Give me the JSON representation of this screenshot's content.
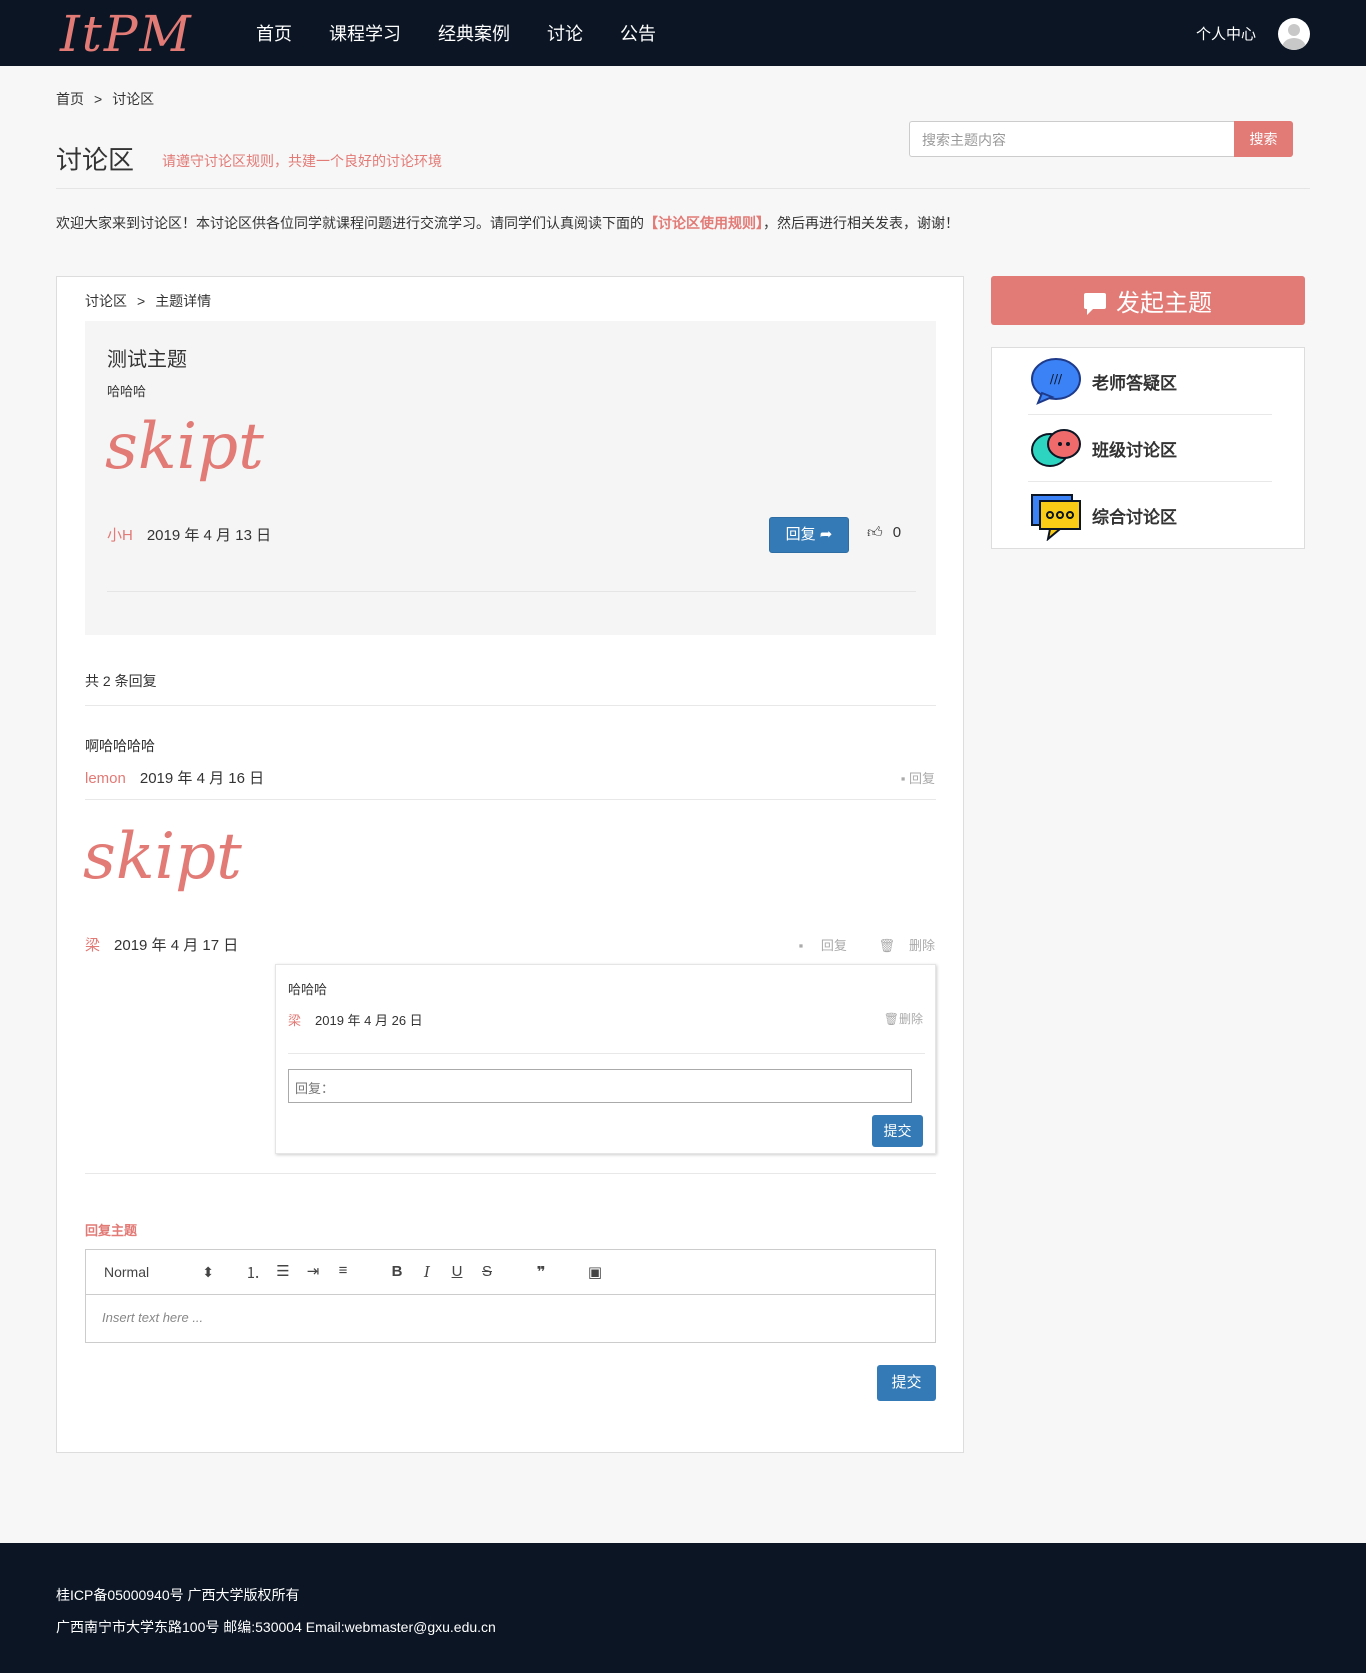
{
  "header": {
    "logo": "ItPM",
    "nav": [
      "首页",
      "课程学习",
      "经典案例",
      "讨论",
      "公告"
    ],
    "user_center": "个人中心"
  },
  "breadcrumb": {
    "home": "首页",
    "sep": ">",
    "current": "讨论区"
  },
  "page": {
    "title": "讨论区",
    "subtitle": "请遵守讨论区规则，共建一个良好的讨论环境",
    "search_placeholder": "搜索主题内容",
    "search_button": "搜索",
    "welcome_before": "欢迎大家来到讨论区！本讨论区供各位同学就课程问题进行交流学习。请同学们认真阅读下面的",
    "welcome_rule": "【讨论区使用规则】",
    "welcome_after": "，然后再进行相关发表，谢谢！"
  },
  "topic_panel": {
    "crumb_parent": "讨论区",
    "crumb_sep": ">",
    "crumb_current": "主题详情",
    "topic": {
      "title": "测试主题",
      "body": "哈哈哈",
      "image_text": "skipt",
      "author": "小H",
      "date": "2019 年 4 月 13 日",
      "reply_button": "回复",
      "likes": "0"
    },
    "reply_count": "共 2 条回复",
    "replies": [
      {
        "text": "啊哈哈哈哈",
        "author": "lemon",
        "date": "2019 年 4 月 16 日",
        "reply_label": "回复"
      },
      {
        "image_text": "skipt",
        "author": "梁",
        "date": "2019 年 4 月 17 日",
        "reply_label": "回复",
        "delete_label": "删除",
        "sub_reply": {
          "text": "哈哈哈",
          "author": "梁",
          "date": "2019 年 4 月 26 日",
          "delete_label": "删除",
          "input_placeholder": "回复：",
          "submit": "提交"
        }
      }
    ],
    "reply_topic_label": "回复主题",
    "editor": {
      "format": "Normal",
      "placeholder": "Insert text here ..."
    },
    "submit": "提交"
  },
  "sidebar": {
    "new_topic": "发起主题",
    "forums": [
      "老师答疑区",
      "班级讨论区",
      "综合讨论区"
    ]
  },
  "footer": {
    "line1": "桂ICP备05000940号 广西大学版权所有",
    "line2": "广西南宁市大学东路100号 邮编:530004 Email:webmaster@gxu.edu.cn"
  },
  "colors": {
    "brand": "#e27a76",
    "header_bg": "#0b1524",
    "primary_button": "#337ab7"
  }
}
